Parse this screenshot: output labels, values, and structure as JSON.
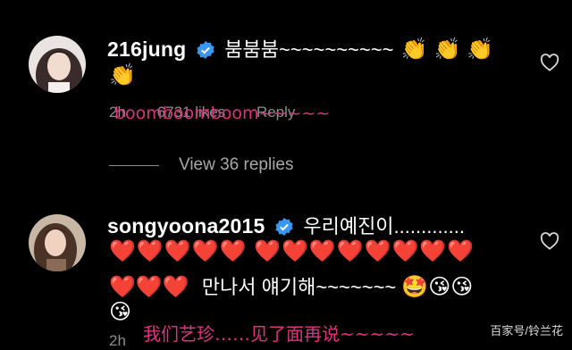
{
  "comments": [
    {
      "username": "216jung",
      "text": "붐붐붐~~~~~~~~~~",
      "emoji_line1": "👏 👏 👏",
      "emoji_line2": "👏",
      "time": "2h",
      "likes": "6731 likes",
      "reply": "Reply",
      "overlay": "boomboomboom~~~~~",
      "view_replies": "View 36 replies"
    },
    {
      "username": "songyoona2015",
      "text": "우리예진이.............",
      "hearts_line": "❤️❤️❤️❤️❤️ ❤️❤️❤️❤️❤️❤️❤️❤️",
      "line3_hearts": "❤️❤️❤️",
      "line3_text": "만나서 얘기해~~~~~~~",
      "line3_emoji": "🤩😘😘",
      "line4_emoji": "😘",
      "time": "2h",
      "overlay": "我们艺珍……见了面再说~~~~~"
    }
  ],
  "watermark": "百家号/铃兰花",
  "colors": {
    "verified": "#3897f0",
    "overlay": "#e0307e",
    "meta": "#8e8e8e"
  }
}
